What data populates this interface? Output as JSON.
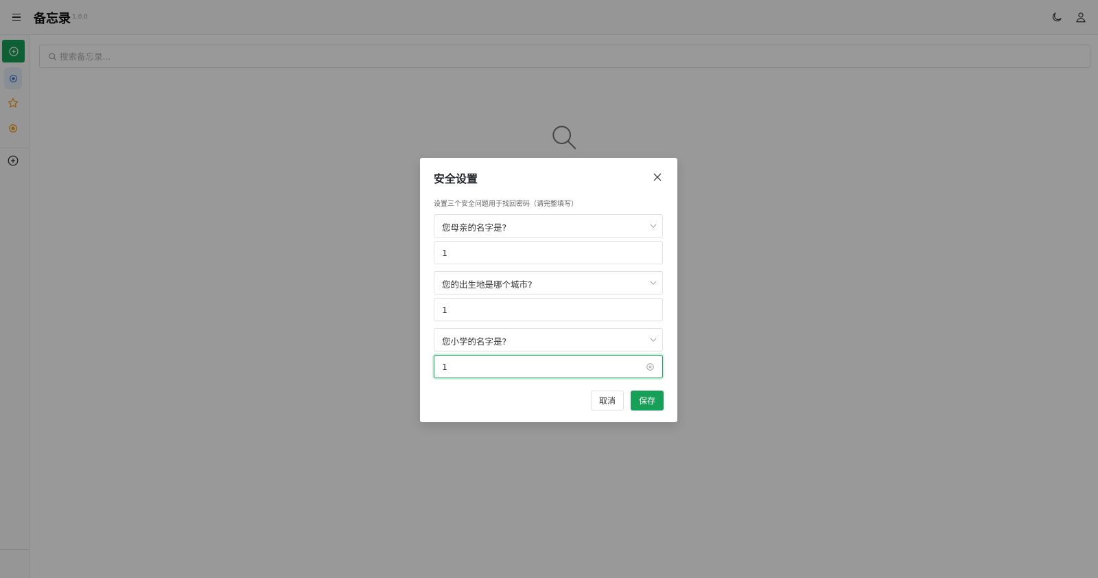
{
  "header": {
    "title": "备忘录",
    "version": "1.0.0",
    "icons": [
      "menu-icon",
      "moon-icon",
      "user-icon"
    ]
  },
  "sidebar": {
    "icons": [
      "add-circle-icon",
      "all-notes-icon",
      "star-icon",
      "category-icon",
      "add-category-icon"
    ]
  },
  "search": {
    "placeholder": "搜索备忘录..."
  },
  "modal": {
    "title": "安全设置",
    "description": "设置三个安全问题用于找回密码（请完整填写）",
    "questions": [
      {
        "question": "您母亲的名字是?",
        "answer": "1"
      },
      {
        "question": "您的出生地是哪个城市?",
        "answer": "1"
      },
      {
        "question": "您小学的名字是?",
        "answer": "1"
      }
    ],
    "cancel_label": "取消",
    "save_label": "保存"
  },
  "colors": {
    "accent": "#18a058",
    "selected_bg": "#e5ebf7",
    "star": "#f0a020"
  }
}
